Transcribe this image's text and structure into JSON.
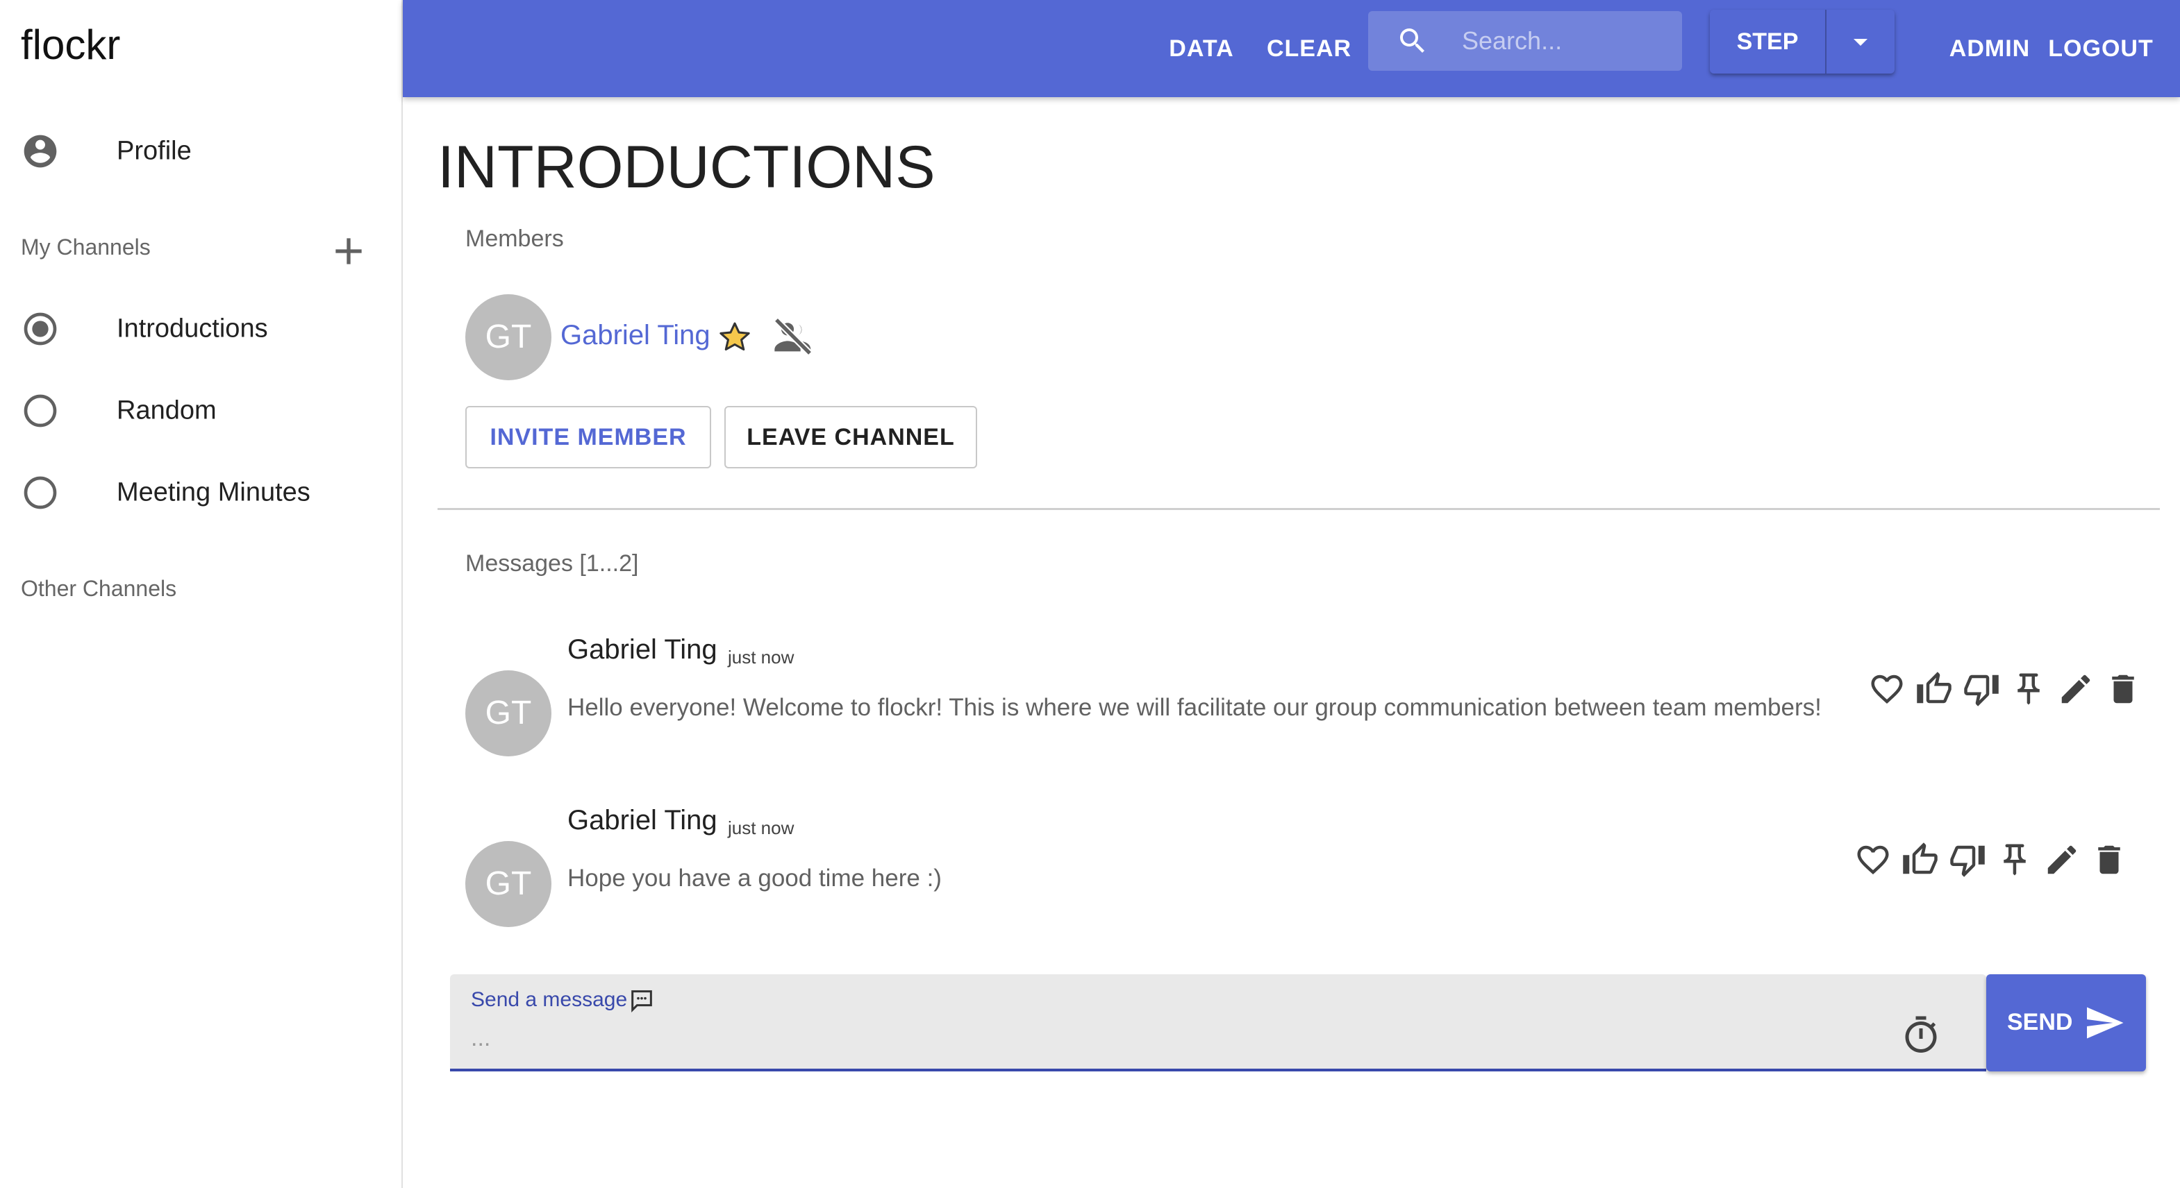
{
  "app": {
    "title": "flockr"
  },
  "sidebar": {
    "profile_label": "Profile",
    "my_channels_header": "My Channels",
    "my_channels": [
      {
        "label": "Introductions",
        "selected": true
      },
      {
        "label": "Random",
        "selected": false
      },
      {
        "label": "Meeting Minutes",
        "selected": false
      }
    ],
    "other_channels_header": "Other Channels"
  },
  "topbar": {
    "data_label": "DATA",
    "clear_label": "CLEAR",
    "search_placeholder": "Search...",
    "step_label": "STEP",
    "admin_label": "ADMIN",
    "logout_label": "LOGOUT",
    "color": "#5468d4"
  },
  "channel": {
    "title": "INTRODUCTIONS",
    "members_header": "Members",
    "members": [
      {
        "initials": "GT",
        "name": "Gabriel Ting",
        "owner": true
      }
    ],
    "invite_label": "INVITE MEMBER",
    "leave_label": "LEAVE CHANNEL",
    "messages_header": "Messages [1...2]",
    "messages": [
      {
        "initials": "GT",
        "author": "Gabriel Ting",
        "time": "just now",
        "text": "Hello everyone! Welcome to flockr! This is where we will facilitate our group communication between team members!"
      },
      {
        "initials": "GT",
        "author": "Gabriel Ting",
        "time": "just now",
        "text": "Hope you have a good time here :)"
      }
    ]
  },
  "composer": {
    "label": "Send a message",
    "placeholder": "...",
    "send_label": "SEND"
  }
}
